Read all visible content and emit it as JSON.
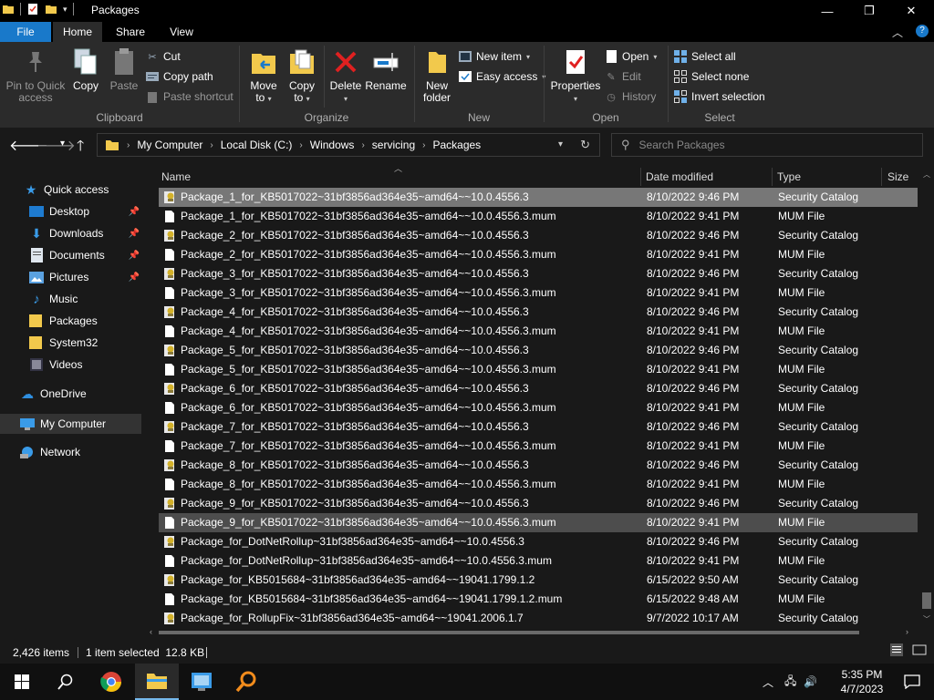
{
  "window": {
    "title": "Packages",
    "minimize_glyph": "—",
    "maximize_glyph": "❐",
    "close_glyph": "✕"
  },
  "tabs": {
    "file": "File",
    "home": "Home",
    "share": "Share",
    "view": "View"
  },
  "ribbon": {
    "clipboard": {
      "label": "Clipboard",
      "pin": "Pin to Quick\naccess",
      "pin1": "Pin to Quick",
      "pin2": "access",
      "copy": "Copy",
      "paste": "Paste",
      "cut": "Cut",
      "copy_path": "Copy path",
      "paste_shortcut": "Paste shortcut"
    },
    "organize": {
      "label": "Organize",
      "move_to1": "Move",
      "move_to2": "to",
      "copy_to1": "Copy",
      "copy_to2": "to",
      "delete": "Delete",
      "rename": "Rename"
    },
    "new": {
      "label": "New",
      "new_folder1": "New",
      "new_folder2": "folder",
      "new_item": "New item",
      "easy_access": "Easy access"
    },
    "open": {
      "label": "Open",
      "properties": "Properties",
      "open": "Open",
      "edit": "Edit",
      "history": "History"
    },
    "select": {
      "label": "Select",
      "select_all": "Select all",
      "select_none": "Select none",
      "invert": "Invert selection"
    }
  },
  "address": {
    "crumbs": [
      "My Computer",
      "Local Disk (C:)",
      "Windows",
      "servicing",
      "Packages"
    ],
    "search_placeholder": "Search Packages"
  },
  "nav": {
    "quick_access": "Quick access",
    "desktop": "Desktop",
    "downloads": "Downloads",
    "documents": "Documents",
    "pictures": "Pictures",
    "music": "Music",
    "packages": "Packages",
    "system32": "System32",
    "videos": "Videos",
    "onedrive": "OneDrive",
    "my_computer": "My Computer",
    "network": "Network"
  },
  "columns": {
    "name": "Name",
    "date": "Date modified",
    "type": "Type",
    "size": "Size"
  },
  "files": [
    {
      "name": "Package_1_for_KB5017022~31bf3856ad364e35~amd64~~10.0.4556.3",
      "date": "8/10/2022 9:46 PM",
      "type": "Security Catalog",
      "kind": "cat",
      "state": "sel"
    },
    {
      "name": "Package_1_for_KB5017022~31bf3856ad364e35~amd64~~10.0.4556.3.mum",
      "date": "8/10/2022 9:41 PM",
      "type": "MUM File",
      "kind": "mum",
      "state": ""
    },
    {
      "name": "Package_2_for_KB5017022~31bf3856ad364e35~amd64~~10.0.4556.3",
      "date": "8/10/2022 9:46 PM",
      "type": "Security Catalog",
      "kind": "cat",
      "state": ""
    },
    {
      "name": "Package_2_for_KB5017022~31bf3856ad364e35~amd64~~10.0.4556.3.mum",
      "date": "8/10/2022 9:41 PM",
      "type": "MUM File",
      "kind": "mum",
      "state": ""
    },
    {
      "name": "Package_3_for_KB5017022~31bf3856ad364e35~amd64~~10.0.4556.3",
      "date": "8/10/2022 9:46 PM",
      "type": "Security Catalog",
      "kind": "cat",
      "state": ""
    },
    {
      "name": "Package_3_for_KB5017022~31bf3856ad364e35~amd64~~10.0.4556.3.mum",
      "date": "8/10/2022 9:41 PM",
      "type": "MUM File",
      "kind": "mum",
      "state": ""
    },
    {
      "name": "Package_4_for_KB5017022~31bf3856ad364e35~amd64~~10.0.4556.3",
      "date": "8/10/2022 9:46 PM",
      "type": "Security Catalog",
      "kind": "cat",
      "state": ""
    },
    {
      "name": "Package_4_for_KB5017022~31bf3856ad364e35~amd64~~10.0.4556.3.mum",
      "date": "8/10/2022 9:41 PM",
      "type": "MUM File",
      "kind": "mum",
      "state": ""
    },
    {
      "name": "Package_5_for_KB5017022~31bf3856ad364e35~amd64~~10.0.4556.3",
      "date": "8/10/2022 9:46 PM",
      "type": "Security Catalog",
      "kind": "cat",
      "state": ""
    },
    {
      "name": "Package_5_for_KB5017022~31bf3856ad364e35~amd64~~10.0.4556.3.mum",
      "date": "8/10/2022 9:41 PM",
      "type": "MUM File",
      "kind": "mum",
      "state": ""
    },
    {
      "name": "Package_6_for_KB5017022~31bf3856ad364e35~amd64~~10.0.4556.3",
      "date": "8/10/2022 9:46 PM",
      "type": "Security Catalog",
      "kind": "cat",
      "state": ""
    },
    {
      "name": "Package_6_for_KB5017022~31bf3856ad364e35~amd64~~10.0.4556.3.mum",
      "date": "8/10/2022 9:41 PM",
      "type": "MUM File",
      "kind": "mum",
      "state": ""
    },
    {
      "name": "Package_7_for_KB5017022~31bf3856ad364e35~amd64~~10.0.4556.3",
      "date": "8/10/2022 9:46 PM",
      "type": "Security Catalog",
      "kind": "cat",
      "state": ""
    },
    {
      "name": "Package_7_for_KB5017022~31bf3856ad364e35~amd64~~10.0.4556.3.mum",
      "date": "8/10/2022 9:41 PM",
      "type": "MUM File",
      "kind": "mum",
      "state": ""
    },
    {
      "name": "Package_8_for_KB5017022~31bf3856ad364e35~amd64~~10.0.4556.3",
      "date": "8/10/2022 9:46 PM",
      "type": "Security Catalog",
      "kind": "cat",
      "state": ""
    },
    {
      "name": "Package_8_for_KB5017022~31bf3856ad364e35~amd64~~10.0.4556.3.mum",
      "date": "8/10/2022 9:41 PM",
      "type": "MUM File",
      "kind": "mum",
      "state": ""
    },
    {
      "name": "Package_9_for_KB5017022~31bf3856ad364e35~amd64~~10.0.4556.3",
      "date": "8/10/2022 9:46 PM",
      "type": "Security Catalog",
      "kind": "cat",
      "state": ""
    },
    {
      "name": "Package_9_for_KB5017022~31bf3856ad364e35~amd64~~10.0.4556.3.mum",
      "date": "8/10/2022 9:41 PM",
      "type": "MUM File",
      "kind": "mum",
      "state": "hover"
    },
    {
      "name": "Package_for_DotNetRollup~31bf3856ad364e35~amd64~~10.0.4556.3",
      "date": "8/10/2022 9:46 PM",
      "type": "Security Catalog",
      "kind": "cat",
      "state": ""
    },
    {
      "name": "Package_for_DotNetRollup~31bf3856ad364e35~amd64~~10.0.4556.3.mum",
      "date": "8/10/2022 9:41 PM",
      "type": "MUM File",
      "kind": "mum",
      "state": ""
    },
    {
      "name": "Package_for_KB5015684~31bf3856ad364e35~amd64~~19041.1799.1.2",
      "date": "6/15/2022 9:50 AM",
      "type": "Security Catalog",
      "kind": "cat",
      "state": ""
    },
    {
      "name": "Package_for_KB5015684~31bf3856ad364e35~amd64~~19041.1799.1.2.mum",
      "date": "6/15/2022 9:48 AM",
      "type": "MUM File",
      "kind": "mum",
      "state": ""
    },
    {
      "name": "Package_for_RollupFix~31bf3856ad364e35~amd64~~19041.2006.1.7",
      "date": "9/7/2022 10:17 AM",
      "type": "Security Catalog",
      "kind": "cat",
      "state": ""
    }
  ],
  "status": {
    "count": "2,426 items",
    "selected": "1 item selected  12.8 KB"
  },
  "taskbar": {
    "time": "5:35 PM",
    "date": "4/7/2023"
  },
  "colors": {
    "accent": "#1979ca",
    "folder": "#f2c94c",
    "selected_row": "#777777"
  }
}
